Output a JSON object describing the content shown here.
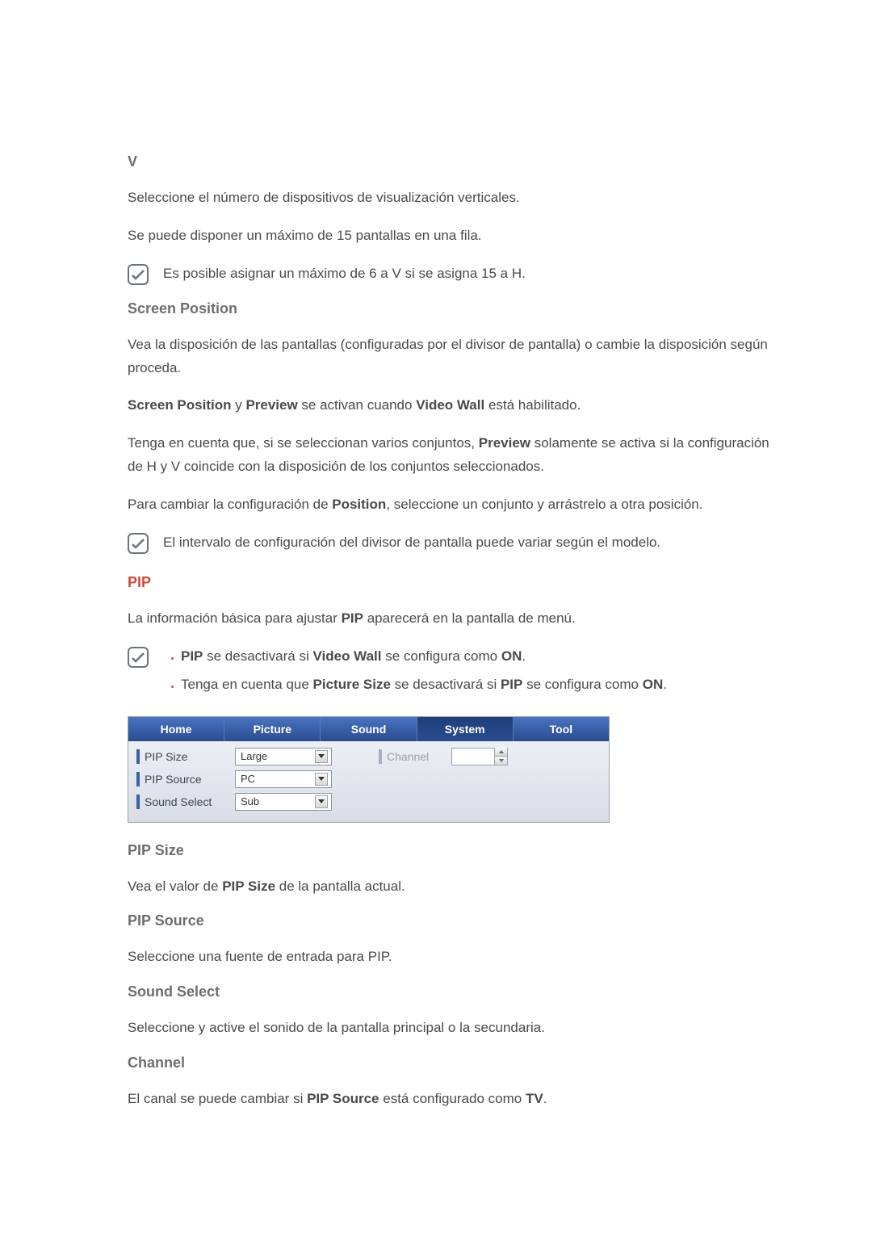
{
  "section_v": {
    "heading": "V",
    "p1": "Seleccione el número de dispositivos de visualización verticales.",
    "p2": "Se puede disponer un máximo de 15 pantallas en una fila.",
    "note": "Es posible asignar un máximo de 6 a V si se asigna 15 a H."
  },
  "section_sp": {
    "heading": "Screen Position",
    "p1": "Vea la disposición de las pantallas (configuradas por el divisor de pantalla) o cambie la disposición según proceda.",
    "p2_pre": "Screen Position",
    "p2_mid1": " y ",
    "p2_b2": "Preview",
    "p2_mid2": " se activan cuando ",
    "p2_b3": "Video Wall",
    "p2_post": " está habilitado.",
    "p3_pre": "Tenga en cuenta que, si se seleccionan varios conjuntos, ",
    "p3_b": "Preview",
    "p3_post": " solamente se activa si la configuración de H y V coincide con la disposición de los conjuntos seleccionados.",
    "p4_pre": "Para cambiar la configuración de ",
    "p4_b": "Position",
    "p4_post": ", seleccione un conjunto y arrástrelo a otra posición.",
    "note": "El intervalo de configuración del divisor de pantalla puede variar según el modelo."
  },
  "section_pip": {
    "heading": "PIP",
    "p1_pre": "La información básica para ajustar ",
    "p1_b": "PIP",
    "p1_post": " aparecerá en la pantalla de menú.",
    "note_li1_b1": "PIP",
    "note_li1_mid1": " se desactivará si ",
    "note_li1_b2": "Video Wall",
    "note_li1_mid2": " se configura como ",
    "note_li1_b3": "ON",
    "note_li1_end": ".",
    "note_li2_pre": "Tenga en cuenta que ",
    "note_li2_b1": "Picture Size",
    "note_li2_mid1": " se desactivará si ",
    "note_li2_b2": "PIP",
    "note_li2_mid2": " se configura como ",
    "note_li2_b3": "ON",
    "note_li2_end": "."
  },
  "ui": {
    "tabs": [
      "Home",
      "Picture",
      "Sound",
      "System",
      "Tool"
    ],
    "active_tab_index": 3,
    "rows": [
      {
        "label": "PIP Size",
        "value": "Large"
      },
      {
        "label": "PIP Source",
        "value": "PC"
      },
      {
        "label": "Sound Select",
        "value": "Sub"
      }
    ],
    "channel_label": "Channel",
    "channel_value": ""
  },
  "sub_pip_size": {
    "heading": "PIP Size",
    "p_pre": "Vea el valor de ",
    "p_b": "PIP Size",
    "p_post": " de la pantalla actual."
  },
  "sub_pip_source": {
    "heading": "PIP Source",
    "p": "Seleccione una fuente de entrada para PIP."
  },
  "sub_sound_select": {
    "heading": "Sound Select",
    "p": "Seleccione y active el sonido de la pantalla principal o la secundaria."
  },
  "sub_channel": {
    "heading": "Channel",
    "p_pre": "El canal se puede cambiar si ",
    "p_b1": "PIP Source",
    "p_mid": " está configurado como ",
    "p_b2": "TV",
    "p_end": "."
  }
}
